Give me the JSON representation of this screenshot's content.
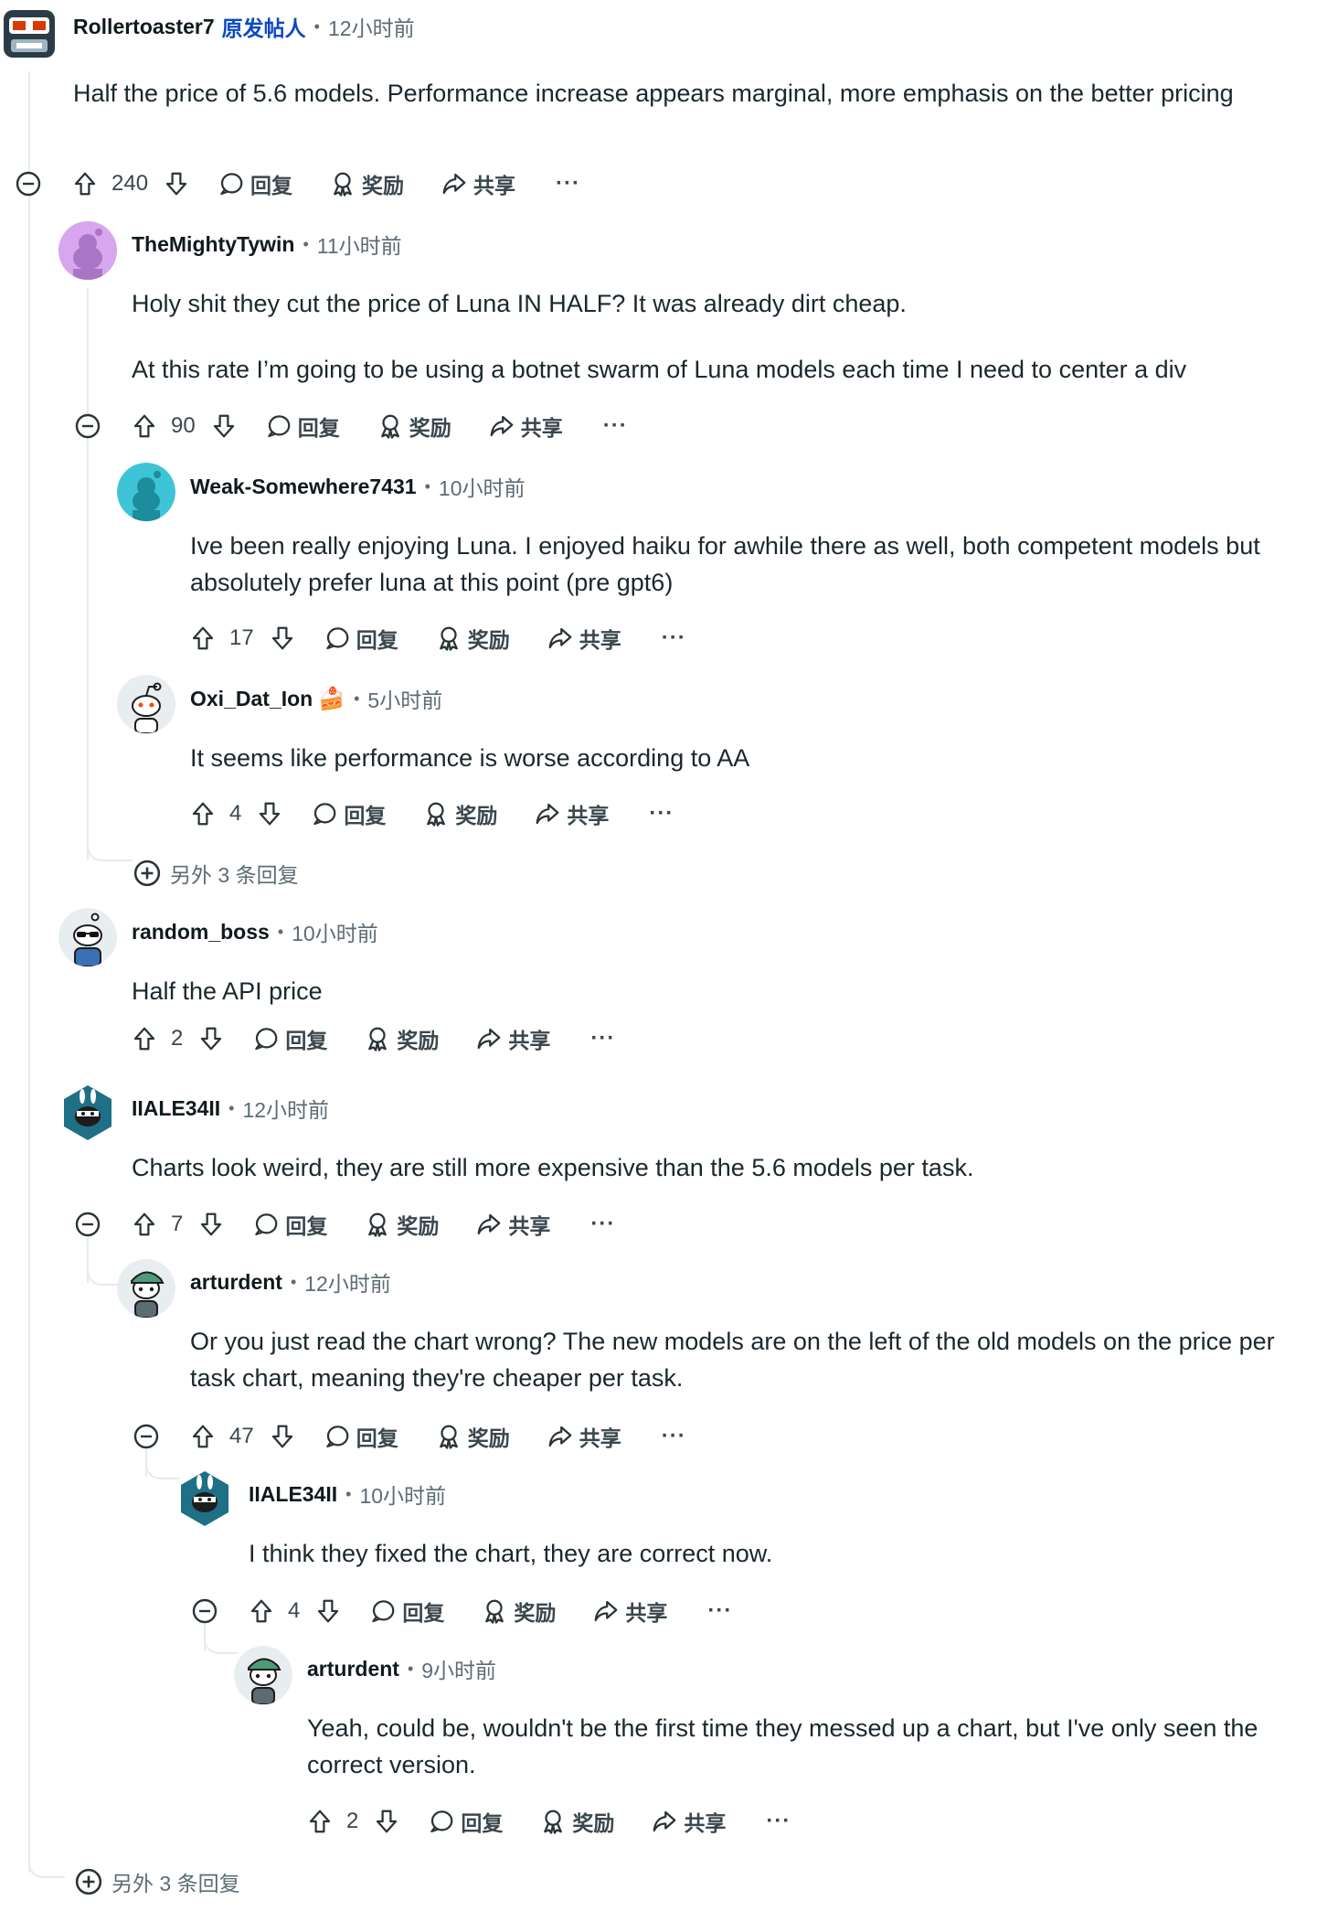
{
  "labels": {
    "reply": "回复",
    "award": "奖励",
    "share": "共享",
    "more": "···"
  },
  "comments": [
    {
      "author": "Rollertoaster7",
      "op_badge": "原发帖人",
      "time": "12小时前",
      "body": [
        "Half the price of 5.6 models. Performance increase appears marginal, more emphasis on the better pricing"
      ],
      "score": "240",
      "avatar_color": "#2a3d46"
    },
    {
      "author": "TheMightyTywin",
      "time": "11小时前",
      "body": [
        "Holy shit they cut the price of Luna IN HALF? It was already dirt cheap.",
        "At this rate I’m going to be using a botnet swarm of Luna models each time I need to center a div"
      ],
      "score": "90",
      "avatar_color": "#b57bd6"
    },
    {
      "author": "Weak-Somewhere7431",
      "time": "10小时前",
      "body": [
        "Ive been really enjoying Luna. I enjoyed haiku for awhile there as well, both competent models but absolutely prefer luna at this point (pre gpt6)"
      ],
      "score": "17",
      "avatar_color": "#3ec4d6"
    },
    {
      "author": "Oxi_Dat_Ion",
      "flair": "🍰",
      "time": "5小时前",
      "body": [
        "It seems like performance is worse according to AA"
      ],
      "score": "4",
      "avatar_color": "#e8edf0"
    },
    {
      "author": "random_boss",
      "time": "10小时前",
      "body": [
        "Half the API price"
      ],
      "score": "2",
      "avatar_color": "#e8edf0"
    },
    {
      "author": "IIALE34II",
      "time": "12小时前",
      "body": [
        "Charts look weird, they are still more expensive than the 5.6 models per task."
      ],
      "score": "7",
      "avatar_color": "#1f6f86"
    },
    {
      "author": "arturdent",
      "time": "12小时前",
      "body": [
        "Or you just read the chart wrong? The new models are on the left of the old models on the price per task chart, meaning they're cheaper per task."
      ],
      "score": "47",
      "avatar_color": "#e8edf0"
    },
    {
      "author": "IIALE34II",
      "time": "10小时前",
      "body": [
        "I think they fixed the chart, they are correct now."
      ],
      "score": "4",
      "avatar_color": "#1f6f86"
    },
    {
      "author": "arturdent",
      "time": "9小时前",
      "body": [
        "Yeah, could be, wouldn't be the first time they messed up a chart, but I've only seen the correct version."
      ],
      "score": "2",
      "avatar_color": "#e8edf0"
    }
  ],
  "more_replies": [
    {
      "label": "另外 3 条回复"
    },
    {
      "label": "另外 3 条回复"
    }
  ]
}
